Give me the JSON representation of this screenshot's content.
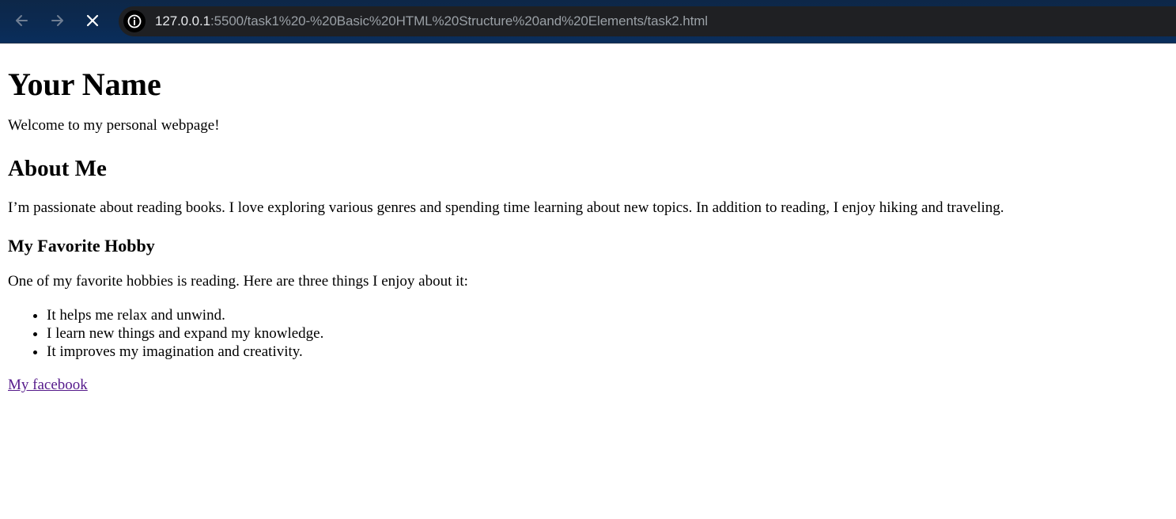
{
  "browser": {
    "url_host": "127.0.0.1",
    "url_path": ":5500/task1%20-%20Basic%20HTML%20Structure%20and%20Elements/task2.html",
    "icons": {
      "back": "arrow-left-icon",
      "forward": "arrow-right-icon",
      "stop": "close-icon",
      "site_info": "info-icon"
    },
    "colors": {
      "toolbar": "#0b2a52",
      "address_bar": "#1f2023",
      "url_host": "#e8eaed",
      "url_path": "#9aa0a6"
    }
  },
  "page": {
    "title": "Your Name",
    "welcome": "Welcome to my personal webpage!",
    "about_heading": "About Me",
    "about_text": "I’m passionate about reading books. I love exploring various genres and spending time learning about new topics. In addition to reading, I enjoy hiking and traveling.",
    "hobby_heading": "My Favorite Hobby",
    "hobby_intro": "One of my favorite hobbies is reading. Here are three things I enjoy about it:",
    "hobby_items": [
      "It helps me relax and unwind.",
      "I learn new things and expand my knowledge.",
      "It improves my imagination and creativity."
    ],
    "link_text": "My facebook",
    "colors": {
      "text": "#000000",
      "visited_link": "#551a8b"
    }
  }
}
